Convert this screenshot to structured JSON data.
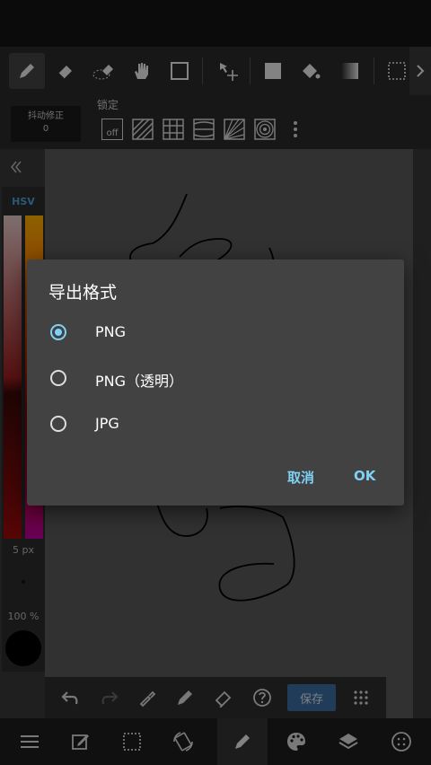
{
  "toolbar": {
    "tools": [
      "pen-icon",
      "eraser-icon",
      "lasso-eraser-icon",
      "hand-icon",
      "rectangle-icon",
      "move-icon",
      "fill-icon",
      "bucket-icon",
      "gradient-icon",
      "selection-icon"
    ],
    "more_icon": "chevron-right-icon"
  },
  "subbar": {
    "stabilizer_label": "抖动修正",
    "stabilizer_value": "0",
    "lock_label": "锁定",
    "lock_off": "off"
  },
  "color_panel": {
    "mode_label": "HSV",
    "brush_size": "5 px",
    "opacity": "100 %",
    "current_color": "#000000"
  },
  "bottom_strip": {
    "save_label": "保存"
  },
  "dialog": {
    "title": "导出格式",
    "options": [
      {
        "label": "PNG",
        "checked": true
      },
      {
        "label": "PNG（透明）",
        "checked": false
      },
      {
        "label": "JPG",
        "checked": false
      }
    ],
    "cancel_label": "取消",
    "ok_label": "OK"
  },
  "colors": {
    "accent": "#7fd1f5",
    "save_button": "#3c6da0",
    "dialog_bg": "#424242"
  }
}
